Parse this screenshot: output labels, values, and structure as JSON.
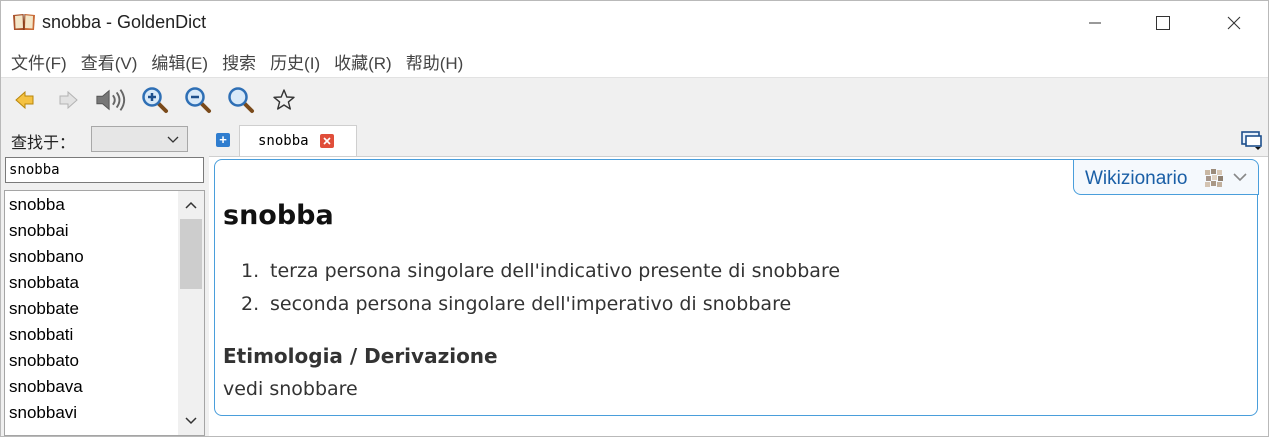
{
  "window": {
    "title": "snobba - GoldenDict"
  },
  "menu": {
    "items": [
      {
        "label": "文件(F)"
      },
      {
        "label": "查看(V)"
      },
      {
        "label": "编辑(E)"
      },
      {
        "label": "搜索"
      },
      {
        "label": "历史(I)"
      },
      {
        "label": "收藏(R)"
      },
      {
        "label": "帮助(H)"
      }
    ]
  },
  "toolbar": {
    "buttons": [
      {
        "icon": "back-arrow-icon",
        "enabled": true
      },
      {
        "icon": "forward-arrow-icon",
        "enabled": false
      },
      {
        "icon": "speaker-icon",
        "enabled": true
      },
      {
        "icon": "zoom-in-icon",
        "enabled": true
      },
      {
        "icon": "zoom-out-icon",
        "enabled": true
      },
      {
        "icon": "zoom-reset-icon",
        "enabled": true
      },
      {
        "icon": "star-icon",
        "enabled": true
      }
    ]
  },
  "search": {
    "look_in_label": "查找于：",
    "look_in_value": "",
    "query": "snobba"
  },
  "word_list": {
    "items": [
      "snobba",
      "snobbai",
      "snobbano",
      "snobbata",
      "snobbate",
      "snobbati",
      "snobbato",
      "snobbava",
      "snobbavi"
    ]
  },
  "tabs": [
    {
      "label": "snobba",
      "active": true
    }
  ],
  "article": {
    "dictionary_name": "Wikizionario",
    "headword": "snobba",
    "definitions": [
      {
        "num": "1.",
        "text": "terza persona singolare dell'indicativo presente di snobbare"
      },
      {
        "num": "2.",
        "text": "seconda persona singolare dell'imperativo di snobbare"
      }
    ],
    "section_title": "Etimologia / Derivazione",
    "section_body": "vedi snobbare"
  },
  "colors": {
    "accent_blue": "#4a9edb",
    "dict_name": "#1a5fa6",
    "tab_close_red": "#e04e3a"
  }
}
